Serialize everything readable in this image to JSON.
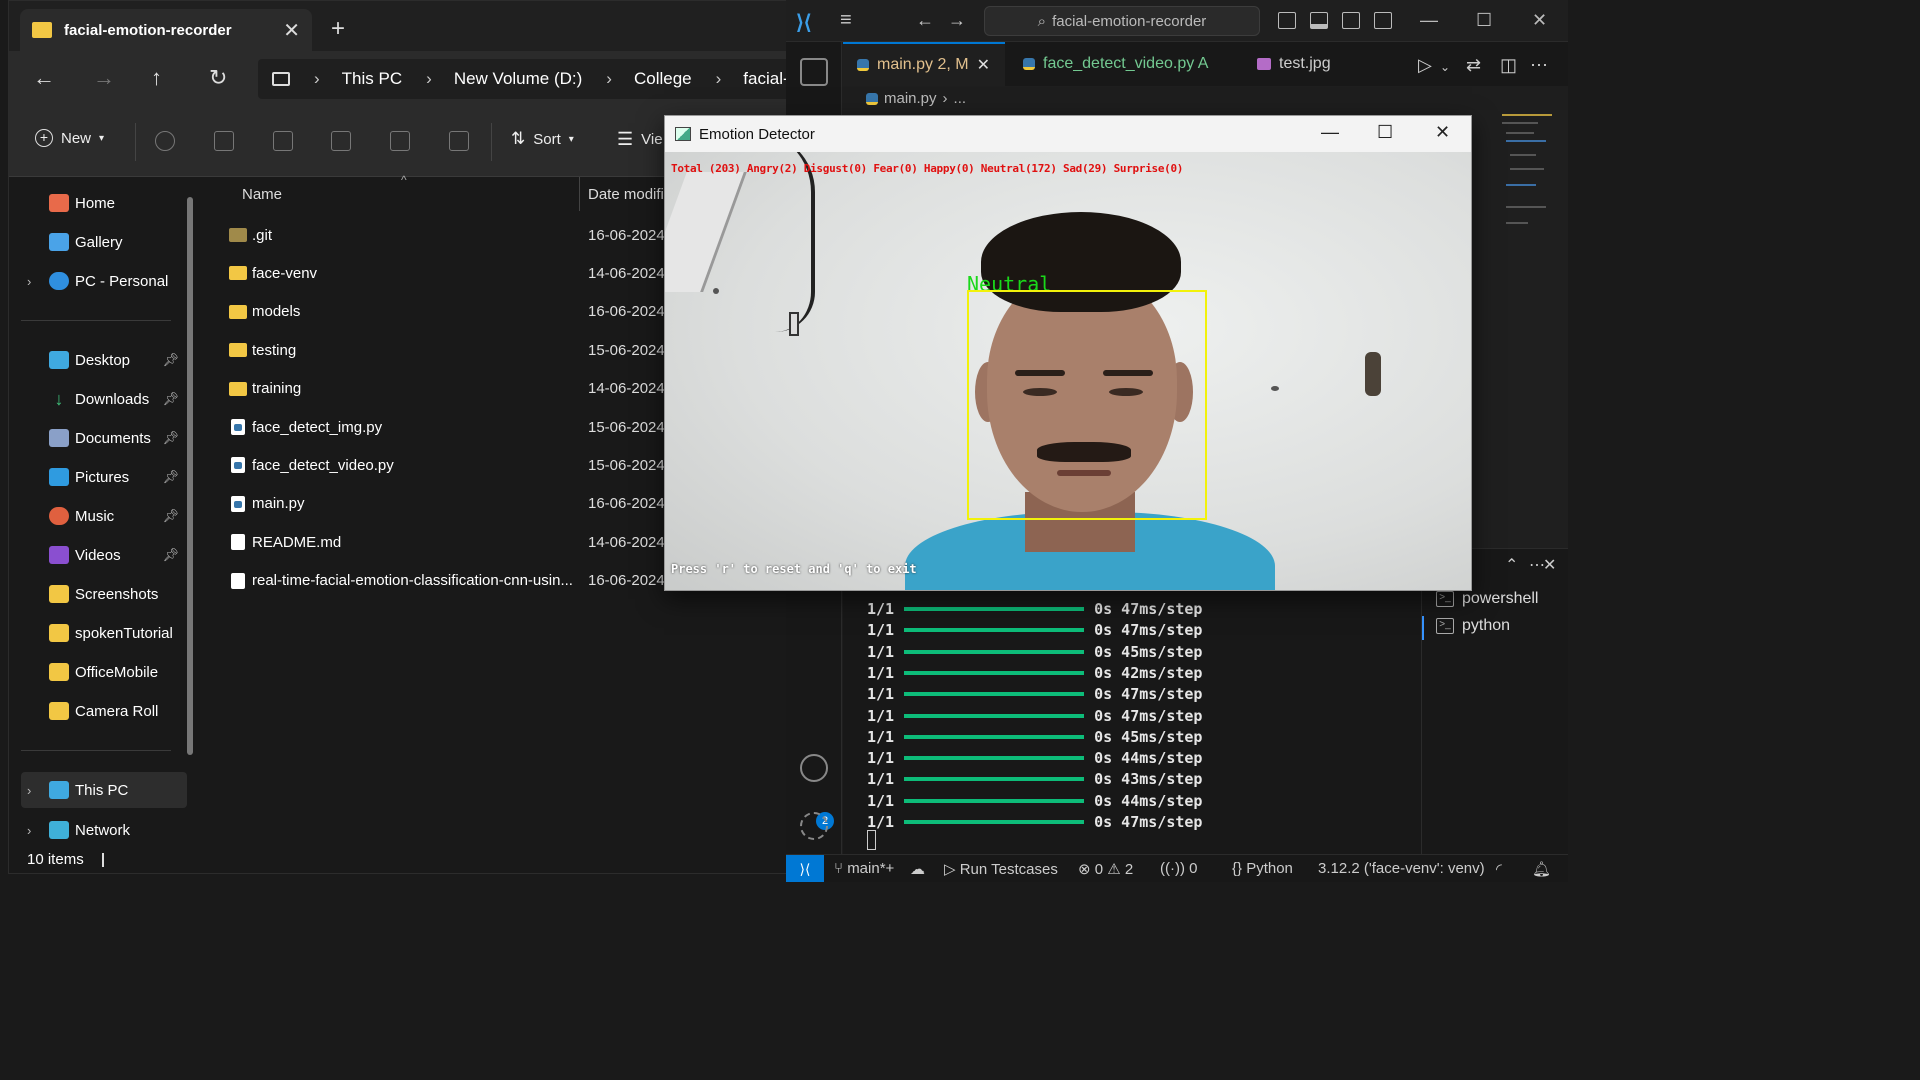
{
  "explorer": {
    "tab_title": "facial-emotion-recorder",
    "breadcrumb": [
      "This PC",
      "New Volume (D:)",
      "College",
      "facial-"
    ],
    "toolbar": {
      "new_label": "New",
      "sort_label": "Sort",
      "view_label": "Vie"
    },
    "nav": {
      "home": "Home",
      "gallery": "Gallery",
      "pc_personal": "PC - Personal",
      "desktop": "Desktop",
      "downloads": "Downloads",
      "documents": "Documents",
      "pictures": "Pictures",
      "music": "Music",
      "videos": "Videos",
      "screenshots": "Screenshots",
      "spoken": "spokenTutorial",
      "officemobile": "OfficeMobile",
      "cameraroll": "Camera Roll",
      "thispc": "This PC",
      "network": "Network"
    },
    "columns": {
      "name": "Name",
      "date": "Date modifi"
    },
    "files": [
      {
        "name": ".git",
        "date": "16-06-2024",
        "type": "folder-hidden"
      },
      {
        "name": "face-venv",
        "date": "14-06-2024",
        "type": "folder"
      },
      {
        "name": "models",
        "date": "16-06-2024",
        "type": "folder"
      },
      {
        "name": "testing",
        "date": "15-06-2024",
        "type": "folder"
      },
      {
        "name": "training",
        "date": "14-06-2024",
        "type": "folder"
      },
      {
        "name": "face_detect_img.py",
        "date": "15-06-2024",
        "type": "py"
      },
      {
        "name": "face_detect_video.py",
        "date": "15-06-2024",
        "type": "py"
      },
      {
        "name": "main.py",
        "date": "16-06-2024",
        "type": "py"
      },
      {
        "name": "README.md",
        "date": "14-06-2024",
        "type": "doc"
      },
      {
        "name": "real-time-facial-emotion-classification-cnn-usin...",
        "date": "16-06-2024",
        "type": "doc"
      }
    ],
    "status": "10 items"
  },
  "vscode": {
    "search": "facial-emotion-recorder",
    "tabs": [
      {
        "label": "main.py 2, M",
        "color": "#e2c08d"
      },
      {
        "label": "face_detect_video.py A",
        "color": "#73c991"
      },
      {
        "label": "test.jpg",
        "color": "#cccccc"
      }
    ],
    "breadcrumb": [
      "main.py",
      "..."
    ],
    "terminal_lines": [
      {
        "step": "1/1",
        "time": "0s 47ms/step"
      },
      {
        "step": "1/1",
        "time": "0s 47ms/step"
      },
      {
        "step": "1/1",
        "time": "0s 45ms/step"
      },
      {
        "step": "1/1",
        "time": "0s 42ms/step"
      },
      {
        "step": "1/1",
        "time": "0s 47ms/step"
      },
      {
        "step": "1/1",
        "time": "0s 47ms/step"
      },
      {
        "step": "1/1",
        "time": "0s 45ms/step"
      },
      {
        "step": "1/1",
        "time": "0s 44ms/step"
      },
      {
        "step": "1/1",
        "time": "0s 43ms/step"
      },
      {
        "step": "1/1",
        "time": "0s 44ms/step"
      },
      {
        "step": "1/1",
        "time": "0s 47ms/step"
      }
    ],
    "terminals": [
      "powershell",
      "python"
    ],
    "accounts_badge": "2",
    "status": {
      "branch": "main*+",
      "run": "Run Testcases",
      "errors": "0",
      "warnings": "2",
      "ports": "0",
      "language": "Python",
      "interpreter": "3.12.2 ('face-venv': venv)"
    }
  },
  "emotion": {
    "title": "Emotion Detector",
    "stats": "Total (203) Angry(2) Disgust(0) Fear(0) Happy(0) Neutral(172) Sad(29) Surprise(0)",
    "face_label": "Neutral",
    "hint": "Press 'r' to reset and 'q' to exit"
  }
}
